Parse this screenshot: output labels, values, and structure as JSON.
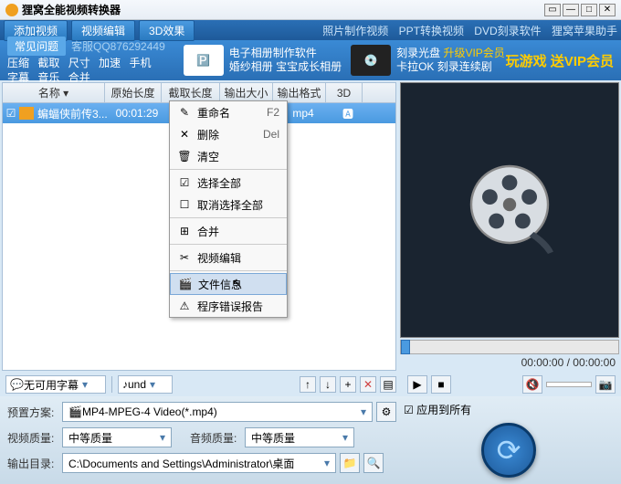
{
  "title": "狸窝全能视频转换器",
  "menu": {
    "add": "添加视频",
    "edit": "视频编辑",
    "fx": "3D效果"
  },
  "rlinks": [
    "照片制作视频",
    "PPT转换视频",
    "DVD刻录软件",
    "狸窝苹果助手"
  ],
  "faq": "常见问题",
  "qq": "客服QQ876292449",
  "ops": [
    "压缩",
    "截取",
    "尺寸",
    "加速",
    "手机",
    "字幕",
    "音乐",
    "合并"
  ],
  "promo1": {
    "l1": "电子相册制作软件",
    "l2": "婚纱相册 宝宝成长相册"
  },
  "promo2": {
    "l1": "刻录光盘",
    "l1b": "升级VIP会员",
    "l2": "卡拉OK 刻录连续剧"
  },
  "bigpromo": "玩游戏  送VIP会员",
  "cols": {
    "name": "名称",
    "orig": "原始长度",
    "cut": "截取长度",
    "size": "输出大小",
    "fmt": "输出格式",
    "td": "3D"
  },
  "file": {
    "name": "蝙蝠侠前传3...",
    "orig": "00:01:29",
    "cut": "",
    "size": "",
    "fmt": "mp4"
  },
  "ctx": [
    {
      "ico": "✎",
      "lbl": "重命名",
      "sc": "F2"
    },
    {
      "ico": "✕",
      "lbl": "删除",
      "sc": "Del"
    },
    {
      "ico": "🗑",
      "lbl": "清空",
      "sc": ""
    },
    "-",
    {
      "ico": "☑",
      "lbl": "选择全部",
      "sc": ""
    },
    {
      "ico": "☐",
      "lbl": "取消选择全部",
      "sc": ""
    },
    "-",
    {
      "ico": "⊞",
      "lbl": "合并",
      "sc": ""
    },
    "-",
    {
      "ico": "✂",
      "lbl": "视频编辑",
      "sc": ""
    },
    "-",
    {
      "ico": "🎬",
      "lbl": "文件信息",
      "sc": "",
      "sel": true
    },
    {
      "ico": "⚠",
      "lbl": "程序错误报告",
      "sc": ""
    }
  ],
  "subtitle": "无可用字幕",
  "audio": "und",
  "time": "00:00:00 / 00:00:00",
  "preset_lbl": "预置方案:",
  "preset": "MP4-MPEG-4 Video(*.mp4)",
  "vq_lbl": "视频质量:",
  "vq": "中等质量",
  "aq_lbl": "音频质量:",
  "aq": "中等质量",
  "out_lbl": "输出目录:",
  "out": "C:\\Documents and Settings\\Administrator\\桌面",
  "apply": "应用到所有"
}
